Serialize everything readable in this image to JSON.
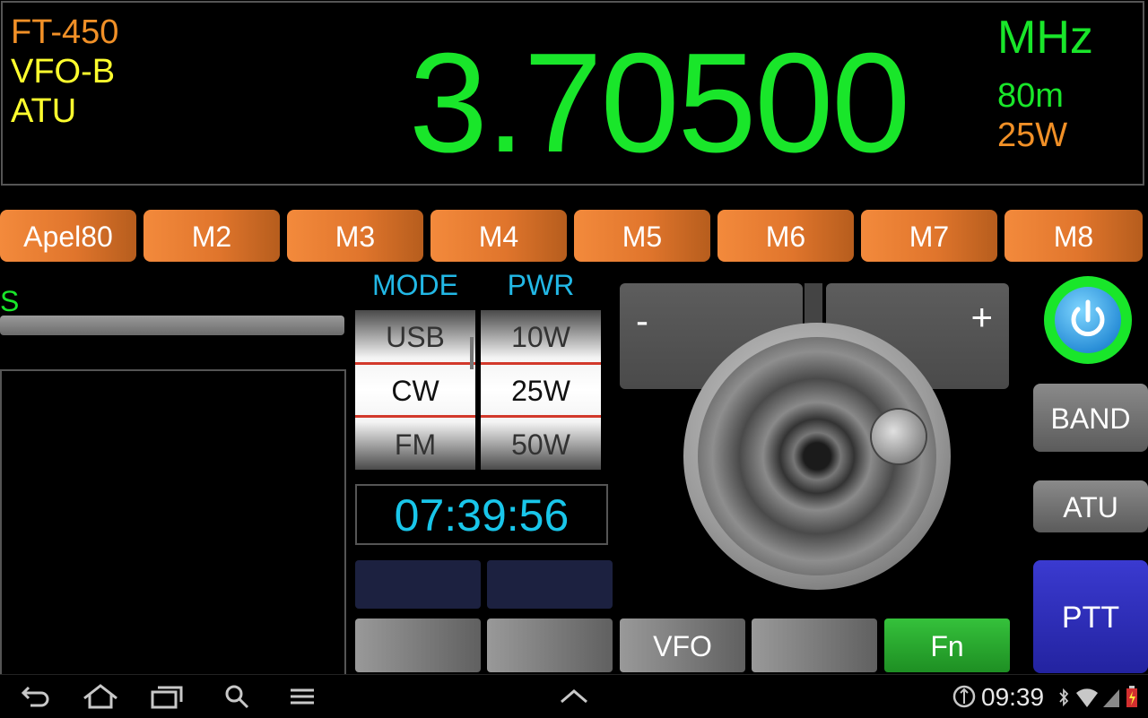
{
  "display": {
    "model": "FT-450",
    "vfo": "VFO-B",
    "atu": "ATU",
    "frequency": "3.70500",
    "unit": "MHz",
    "band": "80m",
    "power": "25W",
    "colors": {
      "model": "#f19027",
      "vfo": "#ffff2e",
      "atu": "#ffff2e",
      "freq": "#19e62a"
    }
  },
  "memories": [
    "Apel80",
    "M2",
    "M3",
    "M4",
    "M5",
    "M6",
    "M7",
    "M8"
  ],
  "meter": {
    "label": "S",
    "level": 0
  },
  "mode": {
    "header": "MODE",
    "options": [
      "USB",
      "CW",
      "FM"
    ],
    "selected": "CW"
  },
  "pwr": {
    "header": "PWR",
    "options": [
      "10W",
      "25W",
      "50W"
    ],
    "selected": "25W"
  },
  "clock": "07:39:56",
  "tuning": {
    "minus": "-",
    "plus": "+"
  },
  "buttons": {
    "vfo": "VFO",
    "fn": "Fn",
    "band": "BAND",
    "atu": "ATU",
    "ptt": "PTT"
  },
  "system_bar": {
    "time": "09:39",
    "icons": [
      "back-icon",
      "home-icon",
      "recent-apps-icon",
      "search-icon",
      "menu-icon",
      "chevron-up-icon",
      "data-sync-icon",
      "bluetooth-icon",
      "wifi-icon",
      "signal-icon",
      "battery-icon"
    ]
  }
}
